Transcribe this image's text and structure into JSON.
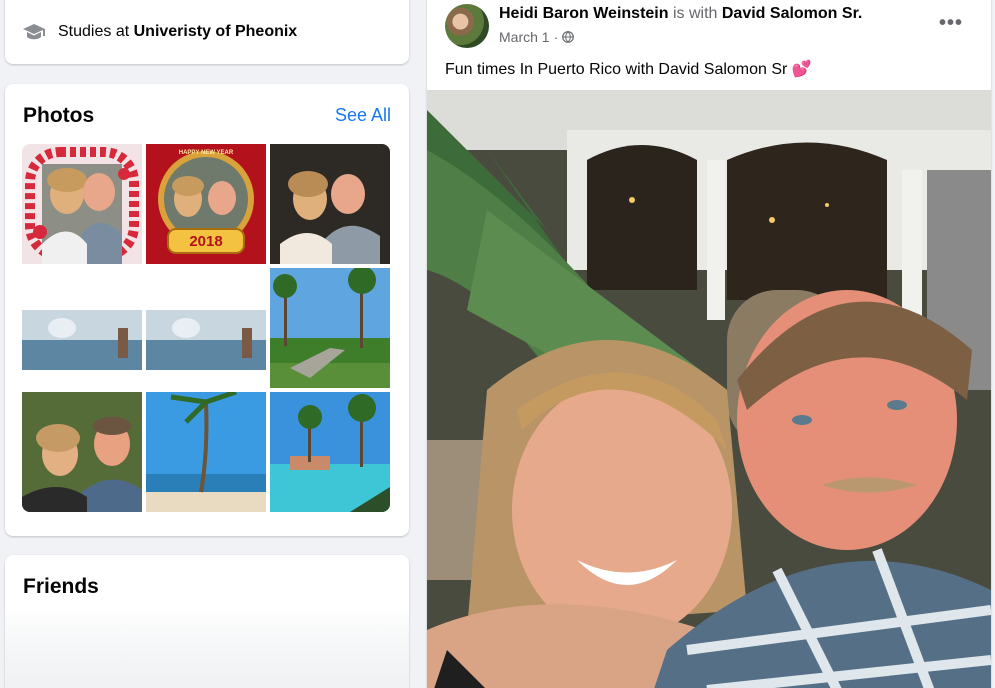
{
  "intro": {
    "studies_prefix": "Studies at",
    "studies_school": "Univeristy of Pheonix"
  },
  "photos": {
    "title": "Photos",
    "see_all": "See All",
    "badge_2018": "2018",
    "new_year": "HAPPY NEW YEAR"
  },
  "friends": {
    "title": "Friends"
  },
  "post": {
    "author": "Heidi Baron Weinstein",
    "with_text": "is with",
    "tagged": "David Salomon Sr.",
    "date": "March 1",
    "separator": "·",
    "more": "•••",
    "caption": "Fun times In Puerto Rico with David Salomon Sr",
    "caption_emoji": "💕"
  },
  "colors": {
    "link": "#1877f2",
    "secondary_text": "#65676b",
    "background": "#f0f2f5"
  }
}
